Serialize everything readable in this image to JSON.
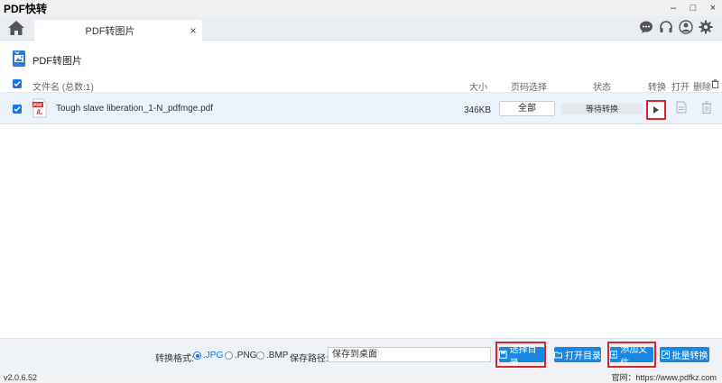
{
  "window": {
    "title": "PDF快转",
    "controls": {
      "minimize": "–",
      "maximize": "□",
      "close": "×"
    }
  },
  "tabs": [
    {
      "label": "PDF转图片",
      "close": "×"
    }
  ],
  "page": {
    "title": "PDF转图片"
  },
  "table": {
    "headers": {
      "filename": "文件名 (总数:1)",
      "size": "大小",
      "pages": "页码选择",
      "status": "状态",
      "convert": "转换",
      "open": "打开",
      "delete": "删除"
    },
    "rows": [
      {
        "name": "Tough slave liberation_1-N_pdfmge.pdf",
        "size": "346KB",
        "pages": "全部",
        "status": "等待转换"
      }
    ]
  },
  "toolbar": {
    "format_label": "转换格式:",
    "formats": [
      {
        "label": ".JPG",
        "selected": true
      },
      {
        "label": ".PNG",
        "selected": false
      },
      {
        "label": ".BMP",
        "selected": false
      }
    ],
    "path_label": "保存路径:",
    "path_value": "保存到桌面",
    "buttons": {
      "choose_dir": "选择目录",
      "open_dir": "打开目录",
      "add_file": "添加文件",
      "batch_convert": "批量转换"
    }
  },
  "footer": {
    "version": "v2.0.6.52",
    "website": "官网：https://www.pdfkz.com"
  },
  "colors": {
    "accent": "#1a88e2",
    "highlight_red": "#d9232d",
    "row_selected": "#eaf3fc"
  }
}
